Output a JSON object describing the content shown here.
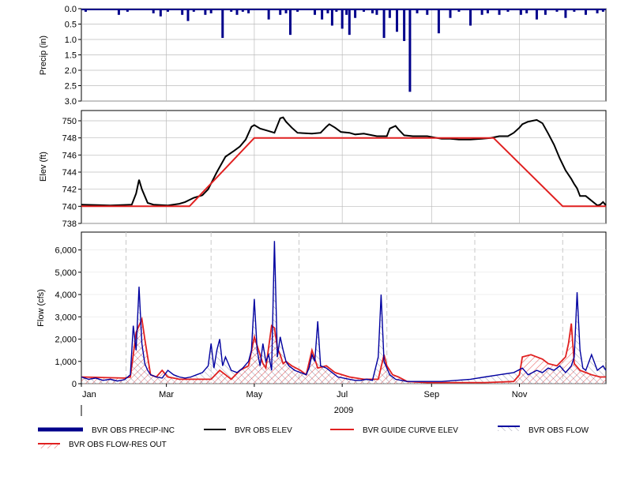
{
  "year_label": "2009",
  "colors": {
    "precip": "#00008b",
    "elev": "#000000",
    "guide": "#e02020",
    "flow": "#0000a0",
    "res_out": "#e02020",
    "grid": "#bbbbbb",
    "dash": "#c8c8c8"
  },
  "legend": {
    "precip": "BVR OBS PRECIP-INC",
    "elev": "BVR OBS ELEV",
    "guide": "BVR GUIDE CURVE ELEV",
    "flow": "BVR OBS FLOW",
    "res_out": "BVR OBS FLOW-RES OUT"
  },
  "chart_data": [
    {
      "type": "bar",
      "ylabel": "Precip (in)",
      "ylim": [
        3.0,
        0.0
      ],
      "yticks": [
        "0.0",
        "0.5",
        "1.0",
        "1.5",
        "2.0",
        "2.5",
        "3.0"
      ],
      "inverted": true,
      "series": [
        {
          "name": "BVR OBS PRECIP-INC",
          "x_day": [
            3,
            14,
            26,
            32,
            38,
            50,
            55,
            60,
            70,
            74,
            78,
            86,
            90,
            98,
            104,
            108,
            112,
            116,
            120,
            130,
            138,
            142,
            145,
            150,
            158,
            162,
            167,
            171,
            174,
            177,
            181,
            184,
            186,
            190,
            196,
            202,
            205,
            210,
            214,
            219,
            224,
            228,
            233,
            240,
            248,
            256,
            262,
            270,
            278,
            282,
            290,
            296,
            302,
            305,
            309,
            316,
            322,
            330,
            336,
            342,
            350,
            358,
            362
          ],
          "values": [
            0.1,
            0.05,
            0.2,
            0.1,
            0.05,
            0.15,
            0.25,
            0.1,
            0.2,
            0.4,
            0.1,
            0.2,
            0.15,
            0.95,
            0.1,
            0.2,
            0.1,
            0.15,
            0.05,
            0.35,
            0.2,
            0.15,
            0.85,
            0.1,
            0.05,
            0.2,
            0.35,
            0.15,
            0.55,
            0.1,
            0.65,
            0.2,
            0.85,
            0.3,
            0.1,
            0.15,
            0.2,
            0.95,
            0.3,
            0.75,
            1.05,
            2.7,
            0.15,
            0.2,
            0.8,
            0.3,
            0.1,
            0.55,
            0.2,
            0.15,
            0.2,
            0.1,
            0.05,
            0.2,
            0.15,
            0.35,
            0.2,
            0.1,
            0.3,
            0.1,
            0.2,
            0.15,
            0.1
          ]
        }
      ]
    },
    {
      "type": "line",
      "ylabel": "Elev (ft)",
      "ylim": [
        738,
        751.2
      ],
      "yticks": [
        "738",
        "740",
        "742",
        "744",
        "746",
        "748",
        "750"
      ],
      "series": [
        {
          "name": "BVR OBS ELEV",
          "x_day": [
            0,
            20,
            35,
            38,
            40,
            42,
            46,
            50,
            60,
            68,
            72,
            78,
            84,
            88,
            94,
            100,
            106,
            110,
            114,
            118,
            120,
            124,
            128,
            134,
            138,
            140,
            142,
            146,
            150,
            160,
            166,
            170,
            172,
            176,
            180,
            186,
            190,
            196,
            205,
            212,
            214,
            218,
            220,
            224,
            230,
            240,
            250,
            256,
            262,
            270,
            278,
            284,
            290,
            296,
            300,
            304,
            306,
            310,
            316,
            320,
            324,
            328,
            332,
            336,
            340,
            342,
            344,
            346,
            350,
            358,
            360,
            362,
            364
          ],
          "values": [
            740.2,
            740.1,
            740.2,
            741.5,
            743.1,
            742.0,
            740.4,
            740.2,
            740.1,
            740.3,
            740.5,
            741.0,
            741.3,
            742.0,
            744.0,
            745.8,
            746.5,
            747.0,
            747.8,
            749.3,
            749.5,
            749.1,
            748.9,
            748.6,
            750.3,
            750.4,
            749.9,
            749.2,
            748.6,
            748.5,
            748.6,
            749.3,
            749.6,
            749.2,
            748.7,
            748.6,
            748.4,
            748.5,
            748.2,
            748.2,
            749.1,
            749.4,
            749.0,
            748.3,
            748.2,
            748.2,
            747.9,
            747.9,
            747.8,
            747.8,
            747.9,
            748.0,
            748.2,
            748.2,
            748.6,
            749.2,
            749.6,
            749.9,
            750.1,
            749.7,
            748.5,
            747.2,
            745.6,
            744.2,
            743.2,
            742.6,
            742.1,
            741.2,
            741.2,
            740.1,
            740.2,
            740.5,
            740.1
          ]
        },
        {
          "name": "BVR GUIDE CURVE ELEV",
          "x_day": [
            0,
            75,
            120,
            286,
            334,
            364
          ],
          "values": [
            740.0,
            740.0,
            748.0,
            748.0,
            740.0,
            740.0
          ]
        }
      ]
    },
    {
      "type": "area",
      "ylabel": "Flow (cfs)",
      "ylim": [
        0,
        6800
      ],
      "yticks": [
        "0",
        "1,000",
        "2,000",
        "3,000",
        "4,000",
        "5,000",
        "6,000"
      ],
      "x_ticks": [
        "Jan",
        "Mar",
        "May",
        "Jul",
        "Sep",
        "Nov"
      ],
      "series": [
        {
          "name": "BVR OBS FLOW",
          "x_day": [
            0,
            5,
            10,
            15,
            20,
            25,
            30,
            34,
            36,
            38,
            40,
            42,
            44,
            46,
            48,
            52,
            56,
            60,
            64,
            68,
            72,
            76,
            80,
            84,
            88,
            90,
            92,
            94,
            96,
            98,
            100,
            104,
            108,
            112,
            116,
            118,
            120,
            122,
            124,
            126,
            128,
            130,
            132,
            134,
            136,
            138,
            140,
            142,
            144,
            148,
            152,
            156,
            158,
            160,
            162,
            164,
            166,
            170,
            174,
            178,
            182,
            186,
            190,
            194,
            198,
            202,
            206,
            208,
            210,
            212,
            214,
            218,
            222,
            226,
            230,
            240,
            250,
            260,
            270,
            280,
            290,
            300,
            306,
            310,
            316,
            320,
            324,
            328,
            332,
            336,
            340,
            342,
            344,
            346,
            348,
            350,
            354,
            358,
            362,
            364
          ],
          "values": [
            300,
            200,
            250,
            150,
            200,
            120,
            180,
            400,
            2600,
            1500,
            4350,
            1800,
            900,
            600,
            400,
            300,
            250,
            600,
            400,
            300,
            250,
            300,
            400,
            500,
            800,
            1800,
            700,
            1500,
            2000,
            800,
            1200,
            600,
            500,
            700,
            1000,
            1500,
            3800,
            1500,
            800,
            1800,
            1000,
            1300,
            600,
            6400,
            1200,
            2100,
            1500,
            1000,
            800,
            600,
            500,
            400,
            700,
            1300,
            1000,
            2800,
            800,
            700,
            500,
            300,
            250,
            200,
            150,
            150,
            200,
            150,
            1200,
            4000,
            1000,
            700,
            400,
            200,
            150,
            100,
            100,
            100,
            100,
            150,
            200,
            300,
            400,
            500,
            700,
            400,
            600,
            500,
            700,
            600,
            800,
            500,
            800,
            1200,
            4100,
            1500,
            700,
            600,
            1300,
            600,
            800,
            600
          ]
        },
        {
          "name": "BVR OBS FLOW-RES OUT",
          "x_day": [
            0,
            30,
            34,
            36,
            38,
            42,
            44,
            46,
            48,
            52,
            56,
            60,
            64,
            68,
            80,
            90,
            96,
            100,
            104,
            110,
            116,
            120,
            124,
            126,
            128,
            132,
            134,
            136,
            138,
            140,
            142,
            146,
            152,
            156,
            160,
            164,
            170,
            176,
            186,
            196,
            206,
            210,
            212,
            214,
            216,
            220,
            226,
            240,
            260,
            280,
            300,
            304,
            306,
            312,
            320,
            324,
            330,
            336,
            338,
            340,
            342,
            346,
            350,
            354,
            360,
            364
          ],
          "values": [
            300,
            250,
            300,
            1300,
            2300,
            2900,
            2000,
            1200,
            400,
            300,
            600,
            300,
            250,
            200,
            200,
            200,
            600,
            400,
            200,
            600,
            800,
            2100,
            1300,
            900,
            700,
            2600,
            2500,
            1600,
            1300,
            900,
            1000,
            800,
            600,
            400,
            1500,
            700,
            800,
            500,
            300,
            200,
            200,
            1300,
            800,
            600,
            400,
            300,
            100,
            50,
            50,
            50,
            100,
            400,
            1200,
            1300,
            1100,
            900,
            800,
            1200,
            1800,
            2700,
            900,
            600,
            500,
            400,
            300,
            300
          ]
        }
      ]
    }
  ]
}
